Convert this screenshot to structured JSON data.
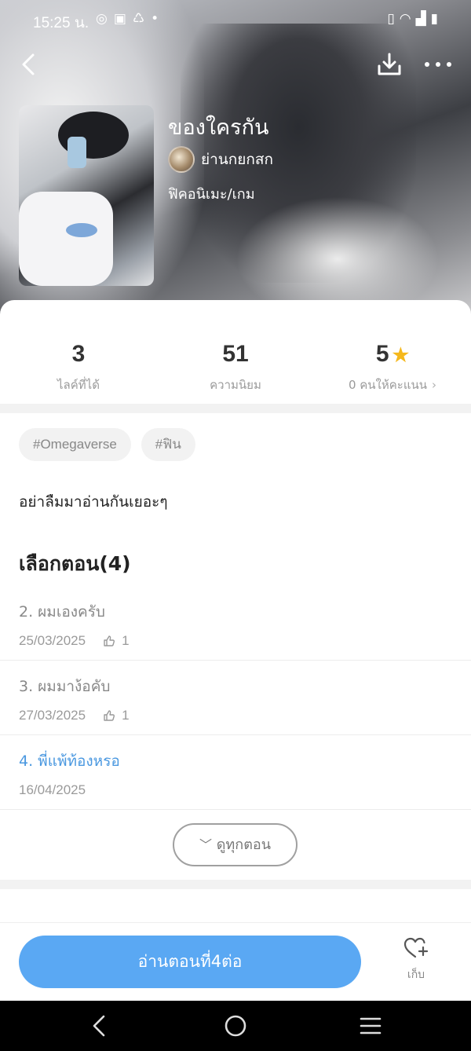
{
  "status_bar": {
    "time": "15:25 น.",
    "left_icons": [
      "instagram-icon",
      "bag-icon",
      "recycle-icon",
      "dot-icon"
    ],
    "right_icons": [
      "vibrate-icon",
      "wifi-icon",
      "signal-icon",
      "battery-icon"
    ]
  },
  "header": {
    "back_icon": "chevron-left-icon",
    "download_icon": "download-icon",
    "more_icon": "more-dots-icon"
  },
  "story": {
    "title": "ของใครกัน",
    "author": "ย่านกยกสก",
    "genre": "ฟิคอนิเมะ/เกม"
  },
  "stats": [
    {
      "value": "3",
      "label": "ไลค์ที่ได้"
    },
    {
      "value": "51",
      "label": "ความนิยม"
    },
    {
      "value": "5",
      "label": "0 คนให้คะแนน"
    }
  ],
  "tags": [
    "#Omegaverse",
    "#ฟิน"
  ],
  "synopsis": "อย่าลืมมาอ่านกันเยอะๆ",
  "episodes": {
    "heading": "เลือกตอน(4)",
    "items": [
      {
        "title": "2. ผมเองครับ",
        "date": "25/03/2025",
        "likes": "1"
      },
      {
        "title": "3. ผมมาง้อคับ",
        "date": "27/03/2025",
        "likes": "1"
      },
      {
        "title": "4. พี่แพ้ท้องหรอ",
        "date": "16/04/2025",
        "likes": ""
      }
    ],
    "view_all": "ดูทุกตอน"
  },
  "actions": {
    "read_label": "อ่านตอนที่4ต่อ",
    "save_label": "เก็บ"
  },
  "colors": {
    "accent": "#5aa8f3",
    "current_episode": "#4a98e0",
    "star": "#f5b81c"
  }
}
